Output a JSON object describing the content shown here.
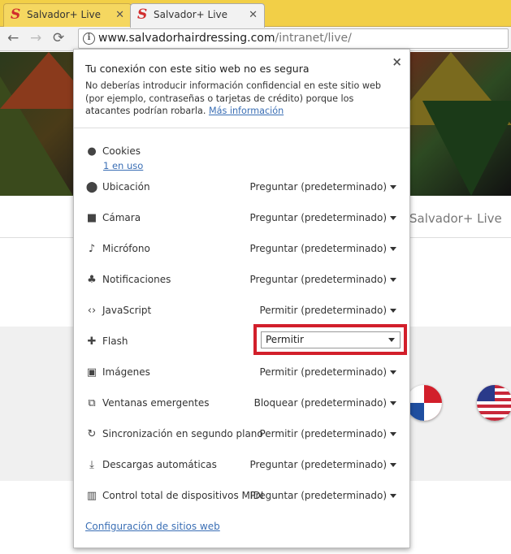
{
  "tabs": [
    {
      "label": "Salvador+ Live (l",
      "favicon": "S"
    },
    {
      "label": "Salvador+ Live (l",
      "favicon": "S"
    }
  ],
  "toolbar": {
    "back": "←",
    "forward": "→",
    "reload": "⟳",
    "info": "i",
    "url_host": "www.salvadorhairdressing.com",
    "url_path": "/intranet/live/"
  },
  "page": {
    "site_title": "Salvador+ Live"
  },
  "popup": {
    "close": "×",
    "security_title": "Tu conexión con este sitio web no es segura",
    "security_text": "No deberías introducir información confidencial en este sitio web (por ejemplo, contraseñas o tarjetas de crédito) porque los atacantes podrían robarla.",
    "more_info": "Más información",
    "cookies": {
      "label": "Cookies",
      "link": "1 en uso"
    },
    "permissions": [
      {
        "icon": "location-icon",
        "label": "Ubicación",
        "value": "Preguntar (predeterminado)"
      },
      {
        "icon": "camera-icon",
        "label": "Cámara",
        "value": "Preguntar (predeterminado)"
      },
      {
        "icon": "microphone-icon",
        "label": "Micrófono",
        "value": "Preguntar (predeterminado)"
      },
      {
        "icon": "bell-icon",
        "label": "Notificaciones",
        "value": "Preguntar (predeterminado)"
      },
      {
        "icon": "code-icon",
        "label": "JavaScript",
        "value": "Permitir (predeterminado)"
      },
      {
        "icon": "puzzle-icon",
        "label": "Flash",
        "value": "Permitir"
      },
      {
        "icon": "image-icon",
        "label": "Imágenes",
        "value": "Permitir (predeterminado)"
      },
      {
        "icon": "popup-icon",
        "label": "Ventanas emergentes",
        "value": "Bloquear (predeterminado)"
      },
      {
        "icon": "sync-icon",
        "label": "Sincronización en segundo plano",
        "value": "Permitir (predeterminado)"
      },
      {
        "icon": "download-icon",
        "label": "Descargas automáticas",
        "value": "Preguntar (predeterminado)"
      },
      {
        "icon": "midi-icon",
        "label": "Control total de dispositivos MIDI",
        "value": "Preguntar (predeterminado)"
      }
    ],
    "footer_link": "Configuración de sitios web"
  },
  "colors": {
    "tab_bar": "#f2cf47",
    "highlight": "#d21f2b",
    "link": "#3b6fb5"
  }
}
